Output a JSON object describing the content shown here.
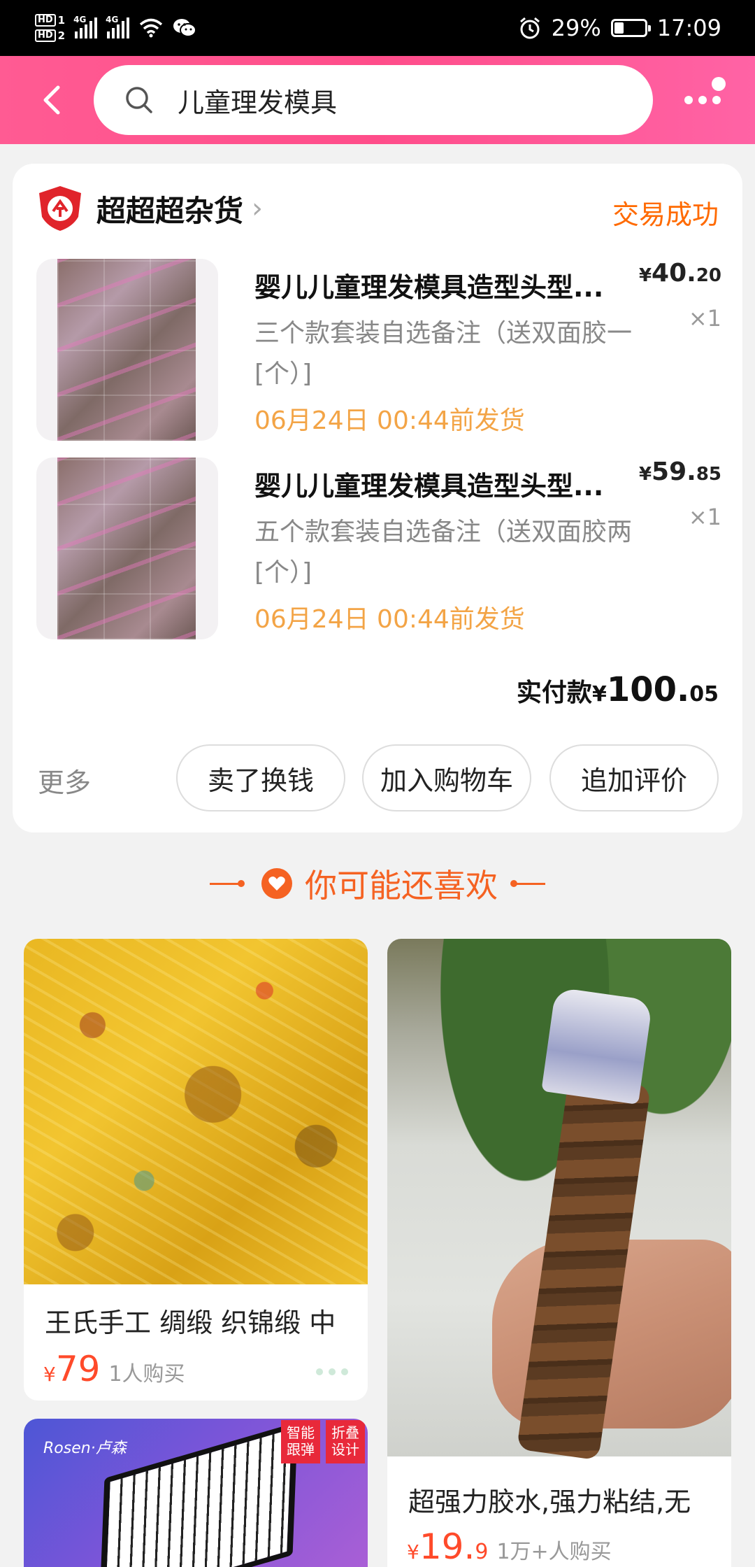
{
  "status_bar": {
    "hd1": "HD",
    "hd1_num": "1",
    "hd2": "HD",
    "hd2_num": "2",
    "net1": "4G",
    "net2": "4G",
    "battery_pct": "29%",
    "time": "17:09",
    "battery_level": 0.29
  },
  "header": {
    "search_text": "儿童理发模具",
    "colors": {
      "gradient_start": "#ff5b93",
      "gradient_end": "#ff63a5"
    }
  },
  "order": {
    "shop_name": "超超超杂货",
    "status": "交易成功",
    "items": [
      {
        "title": "婴儿儿童理发模具造型头型...",
        "spec": "三个款套装自选备注（送双面胶一[个）]",
        "ship": "06月24日 00:44前发货",
        "price_symbol": "¥",
        "price_int": "40.",
        "price_dec": "20",
        "qty": "×1"
      },
      {
        "title": "婴儿儿童理发模具造型头型...",
        "spec": "五个款套装自选备注（送双面胶两[个）]",
        "ship": "06月24日 00:44前发货",
        "price_symbol": "¥",
        "price_int": "59.",
        "price_dec": "85",
        "qty": "×1"
      }
    ],
    "paid_label": "实付款",
    "paid_symbol": "¥",
    "paid_int": "100.",
    "paid_dec": "05",
    "more_label": "更多",
    "actions": [
      "卖了换钱",
      "加入购物车",
      "追加评价"
    ]
  },
  "recommend": {
    "title": "你可能还喜欢",
    "accent": "#f56222",
    "products": [
      {
        "title": "王氏手工 绸缎 织锦缎 中",
        "price_symbol": "¥",
        "price_int": "79",
        "price_dec": "",
        "sold": "1人购买"
      },
      {
        "title": "超强力胶水,强力粘结,无",
        "price_symbol": "¥",
        "price_int": "19.",
        "price_dec": "9",
        "sold": "1万+人购买"
      },
      {
        "logo": "Rosen·卢森",
        "badge1": "智能跟弹",
        "badge2": "折叠设计"
      }
    ]
  }
}
